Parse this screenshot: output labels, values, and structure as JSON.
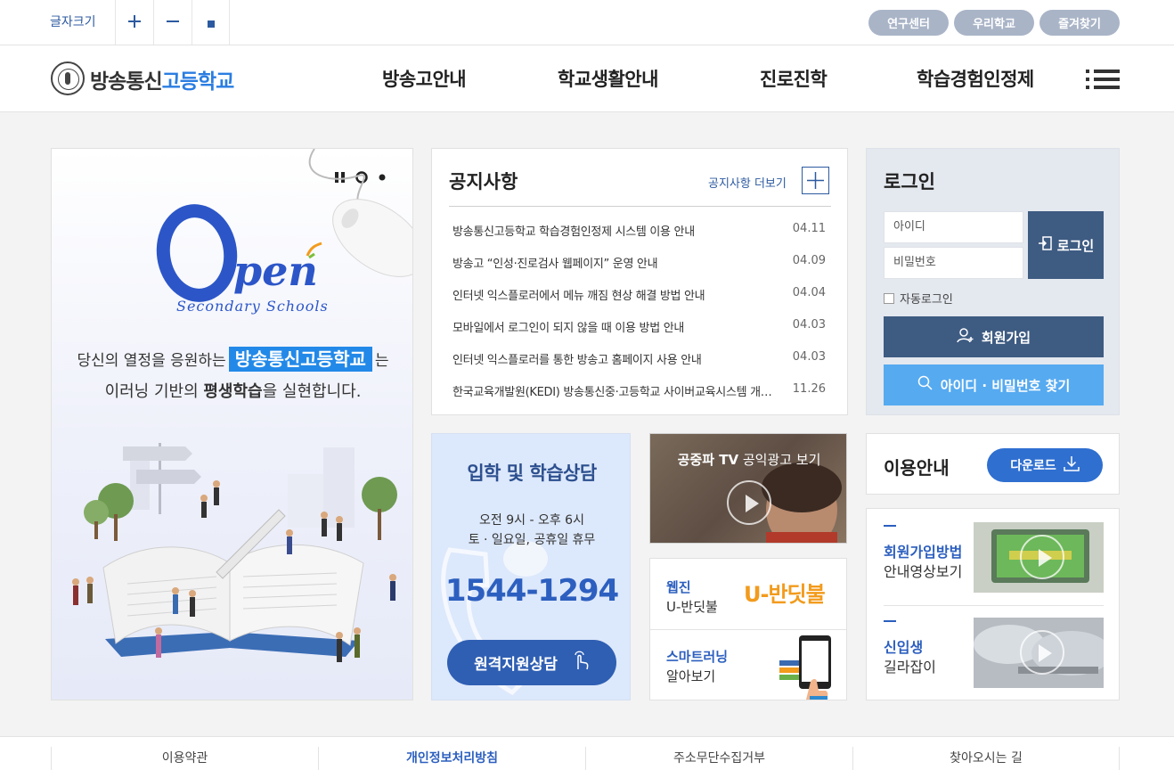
{
  "topbar": {
    "fontsize_label": "글자크기",
    "fontsize_buttons": [
      "+",
      "−",
      "■"
    ],
    "pills": [
      "연구센터",
      "우리학교",
      "즐겨찾기"
    ]
  },
  "header": {
    "logo_part1": "방송통신",
    "logo_part2": "고등학교",
    "nav": [
      "방송고안내",
      "학교생활안내",
      "진로진학",
      "학습경험인정제"
    ]
  },
  "banner": {
    "open_pen": "pen",
    "open_sub": "Secondary Schools",
    "line1_pre": "당신의 열정을 응원하는",
    "line1_highlight": "방송통신고등학교",
    "line1_post": "는",
    "line2_pre": "이러닝 기반의 ",
    "line2_bold": "평생학습",
    "line2_post": "을 실현합니다."
  },
  "notice": {
    "title": "공지사항",
    "more": "공지사항 더보기",
    "items": [
      {
        "title": "방송통신고등학교 학습경험인정제 시스템 이용 안내",
        "date": "04.11"
      },
      {
        "title": "방송고 “인성·진로검사 웹페이지” 운영 안내",
        "date": "04.09"
      },
      {
        "title": "인터넷 익스플로러에서 메뉴 깨짐 현상 해결 방법 안내",
        "date": "04.04"
      },
      {
        "title": "모바일에서 로그인이 되지 않을 때 이용 방법 안내",
        "date": "04.03"
      },
      {
        "title": "인터넷 익스플로러를 통한 방송고 홈페이지 사용 안내",
        "date": "04.03"
      },
      {
        "title": "한국교육개발원(KEDI) 방송통신중·고등학교 사이버교육시스템 개인정보 처리방침 안내",
        "date": "11.26"
      }
    ]
  },
  "login": {
    "title": "로그인",
    "id_placeholder": "아이디",
    "pw_placeholder": "비밀번호",
    "login_button": "로그인",
    "auto_login": "자동로그인",
    "signup_button": "회원가입",
    "find_button": "아이디 · 비밀번호 찾기",
    "signup_color": "#3e5b82",
    "find_color": "#56aaf0"
  },
  "consult": {
    "title": "입학 및 학습상담",
    "hours_line1": "오전 9시 - 오후 6시",
    "hours_line2": "토 · 일요일, 공휴일 휴무",
    "phone": "1544-1294",
    "remote_button": "원격지원상담"
  },
  "tv": {
    "label_bold": "공중파 TV",
    "label_rest": " 공익광고 보기"
  },
  "webzine": {
    "a_line1": "웹진",
    "a_line2": "U-반딧불",
    "a_logo": "U-반딧불",
    "b_line1": "스마트러닝",
    "b_line2": "알아보기"
  },
  "guide": {
    "title": "이용안내",
    "download": "다운로드"
  },
  "videos": [
    {
      "line1": "회원가입방법",
      "line2": "안내영상보기"
    },
    {
      "line1": "신입생",
      "line2": "길라잡이"
    }
  ],
  "footer": [
    "이용약관",
    "개인정보처리방침",
    "주소무단수집거부",
    "찾아오시는 길"
  ]
}
